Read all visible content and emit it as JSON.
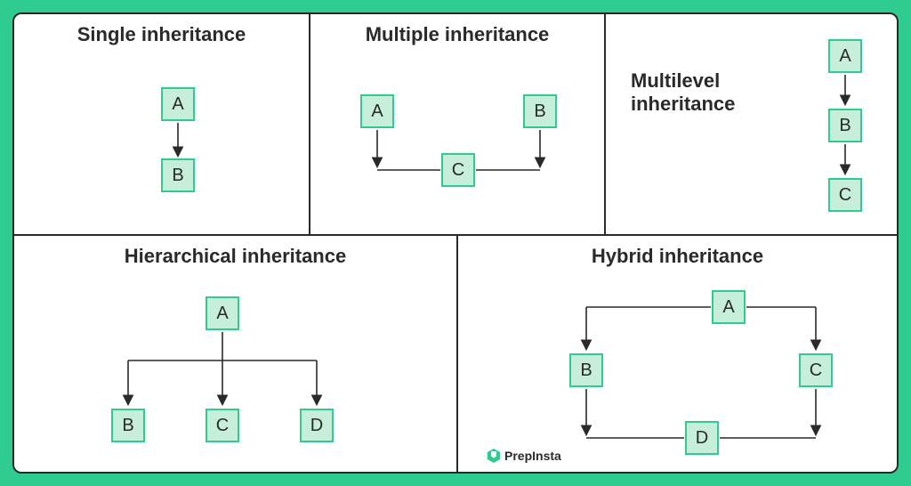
{
  "panels": {
    "single": {
      "title": "Single inheritance",
      "nodes": {
        "a": "A",
        "b": "B"
      }
    },
    "multiple": {
      "title": "Multiple inheritance",
      "nodes": {
        "a": "A",
        "b": "B",
        "c": "C"
      }
    },
    "multilevel": {
      "title": "Multilevel inheritance",
      "nodes": {
        "a": "A",
        "b": "B",
        "c": "C"
      }
    },
    "hierarchical": {
      "title": "Hierarchical inheritance",
      "nodes": {
        "a": "A",
        "b": "B",
        "c": "C",
        "d": "D"
      }
    },
    "hybrid": {
      "title": "Hybrid inheritance",
      "nodes": {
        "a": "A",
        "b": "B",
        "c": "C",
        "d": "D"
      }
    }
  },
  "brand": "PrepInsta",
  "colors": {
    "bg": "#2ecc8f",
    "node_fill": "#c7eedb",
    "node_border": "#2ecc8f",
    "line": "#2a2a2a"
  }
}
